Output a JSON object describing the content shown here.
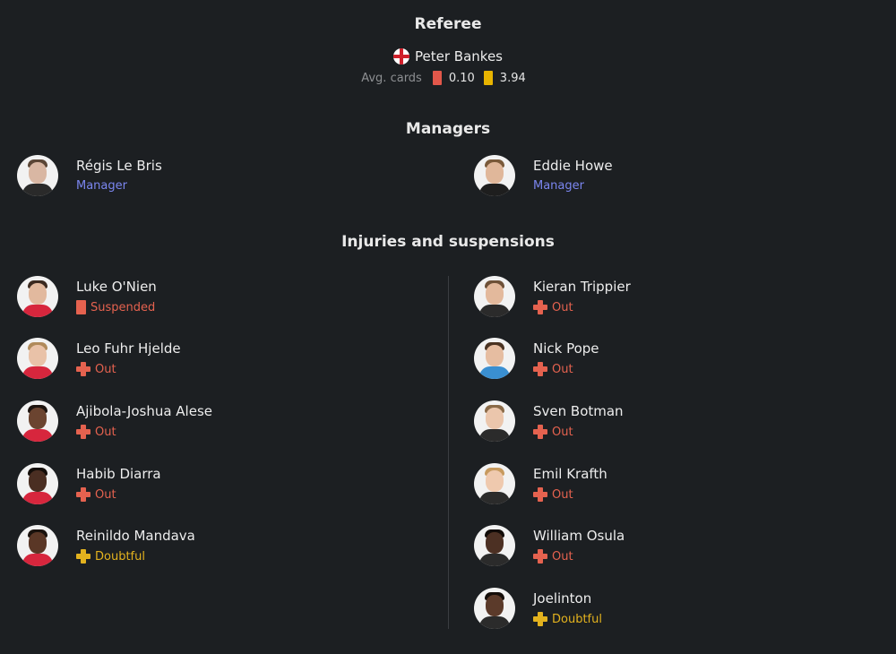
{
  "referee": {
    "title": "Referee",
    "name": "Peter Bankes",
    "flag_icon": "england-flag-icon",
    "avg_cards_label": "Avg. cards",
    "red_avg": "0.10",
    "yellow_avg": "3.94",
    "red_color": "#e2574a",
    "yellow_color": "#e8b400"
  },
  "managers": {
    "title": "Managers",
    "home": {
      "name": "Régis Le Bris",
      "role": "Manager"
    },
    "away": {
      "name": "Eddie Howe",
      "role": "Manager"
    }
  },
  "injuries": {
    "title": "Injuries and suspensions",
    "home": [
      {
        "name": "Luke O'Nien",
        "status": "Suspended"
      },
      {
        "name": "Leo Fuhr Hjelde",
        "status": "Out"
      },
      {
        "name": "Ajibola-Joshua Alese",
        "status": "Out"
      },
      {
        "name": "Habib Diarra",
        "status": "Out"
      },
      {
        "name": "Reinildo Mandava",
        "status": "Doubtful"
      }
    ],
    "away": [
      {
        "name": "Kieran Trippier",
        "status": "Out"
      },
      {
        "name": "Nick Pope",
        "status": "Out"
      },
      {
        "name": "Sven Botman",
        "status": "Out"
      },
      {
        "name": "Emil Krafth",
        "status": "Out"
      },
      {
        "name": "William Osula",
        "status": "Out"
      },
      {
        "name": "Joelinton",
        "status": "Doubtful"
      }
    ]
  },
  "colors": {
    "background": "#1c1f22",
    "role_accent": "#7b86f0",
    "out": "#e5624f",
    "doubtful": "#e3b21e"
  }
}
